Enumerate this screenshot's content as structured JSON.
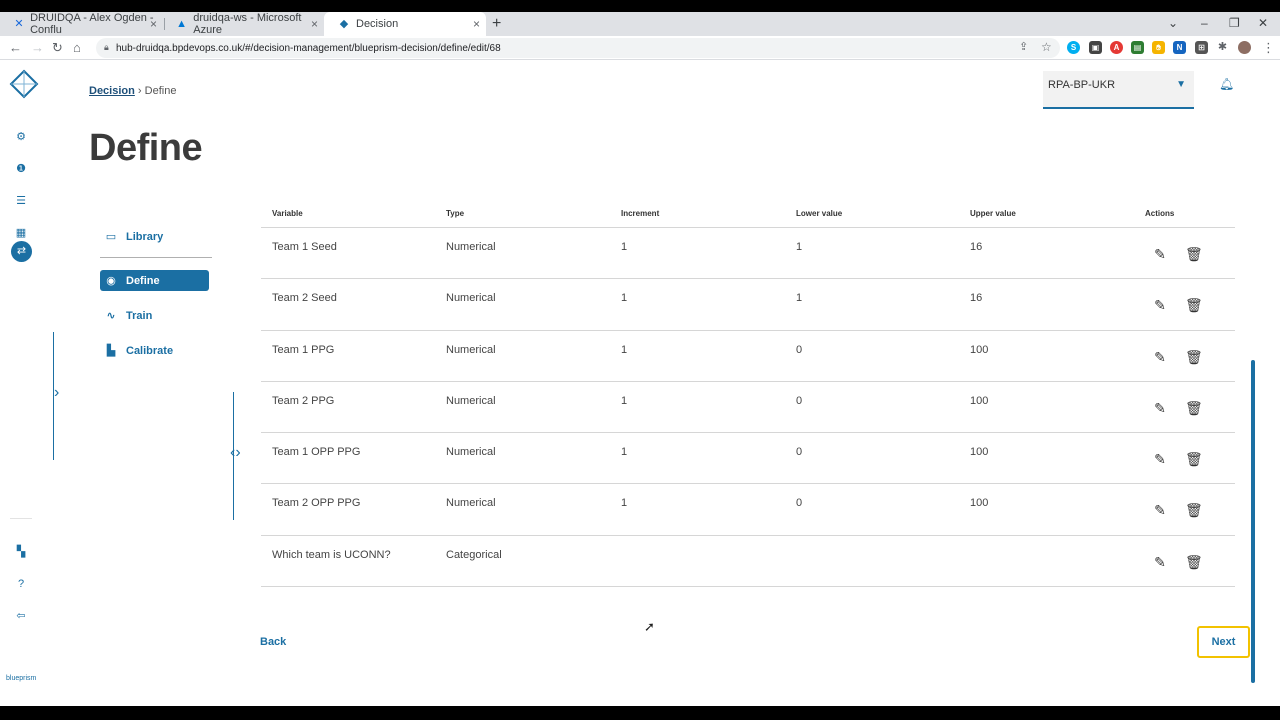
{
  "browser": {
    "tabs": [
      {
        "title": "DRUIDQA - Alex Ogden - Conflu",
        "icon": "confluence-icon",
        "color": "#1868db"
      },
      {
        "title": "druidqa-ws - Microsoft Azure",
        "icon": "azure-icon",
        "color": "#0078d4"
      },
      {
        "title": "Decision",
        "icon": "decision-icon",
        "color": "#1b6fa3"
      }
    ],
    "url": "hub-druidqa.bpdevops.co.uk/#/decision-management/blueprism-decision/define/edit/68"
  },
  "header": {
    "tenant": "RPA-BP-UKR"
  },
  "breadcrumb": {
    "parent": "Decision",
    "separator": "›",
    "current": "Define"
  },
  "page": {
    "title": "Define"
  },
  "steps": [
    {
      "label": "Library",
      "icon": "library-icon"
    },
    {
      "label": "Define",
      "icon": "define-icon",
      "active": true
    },
    {
      "label": "Train",
      "icon": "train-icon"
    },
    {
      "label": "Calibrate",
      "icon": "calibrate-icon"
    }
  ],
  "table": {
    "columns": [
      "Variable",
      "Type",
      "Increment",
      "Lower value",
      "Upper value",
      "Actions"
    ],
    "rows": [
      {
        "variable": "Team 1 Seed",
        "type": "Numerical",
        "increment": "1",
        "lower": "1",
        "upper": "16"
      },
      {
        "variable": "Team 2 Seed",
        "type": "Numerical",
        "increment": "1",
        "lower": "1",
        "upper": "16"
      },
      {
        "variable": "Team 1 PPG",
        "type": "Numerical",
        "increment": "1",
        "lower": "0",
        "upper": "100"
      },
      {
        "variable": "Team 2 PPG",
        "type": "Numerical",
        "increment": "1",
        "lower": "0",
        "upper": "100"
      },
      {
        "variable": "Team 1 OPP PPG",
        "type": "Numerical",
        "increment": "1",
        "lower": "0",
        "upper": "100"
      },
      {
        "variable": "Team 2 OPP PPG",
        "type": "Numerical",
        "increment": "1",
        "lower": "0",
        "upper": "100"
      },
      {
        "variable": "Which team is UCONN?",
        "type": "Categorical",
        "increment": "",
        "lower": "",
        "upper": ""
      }
    ]
  },
  "footer": {
    "back_label": "Back",
    "next_label": "Next"
  },
  "rail": {
    "brand": "blueprism"
  },
  "colors": {
    "accent": "#1b6fa3",
    "focus": "#f2c200"
  }
}
